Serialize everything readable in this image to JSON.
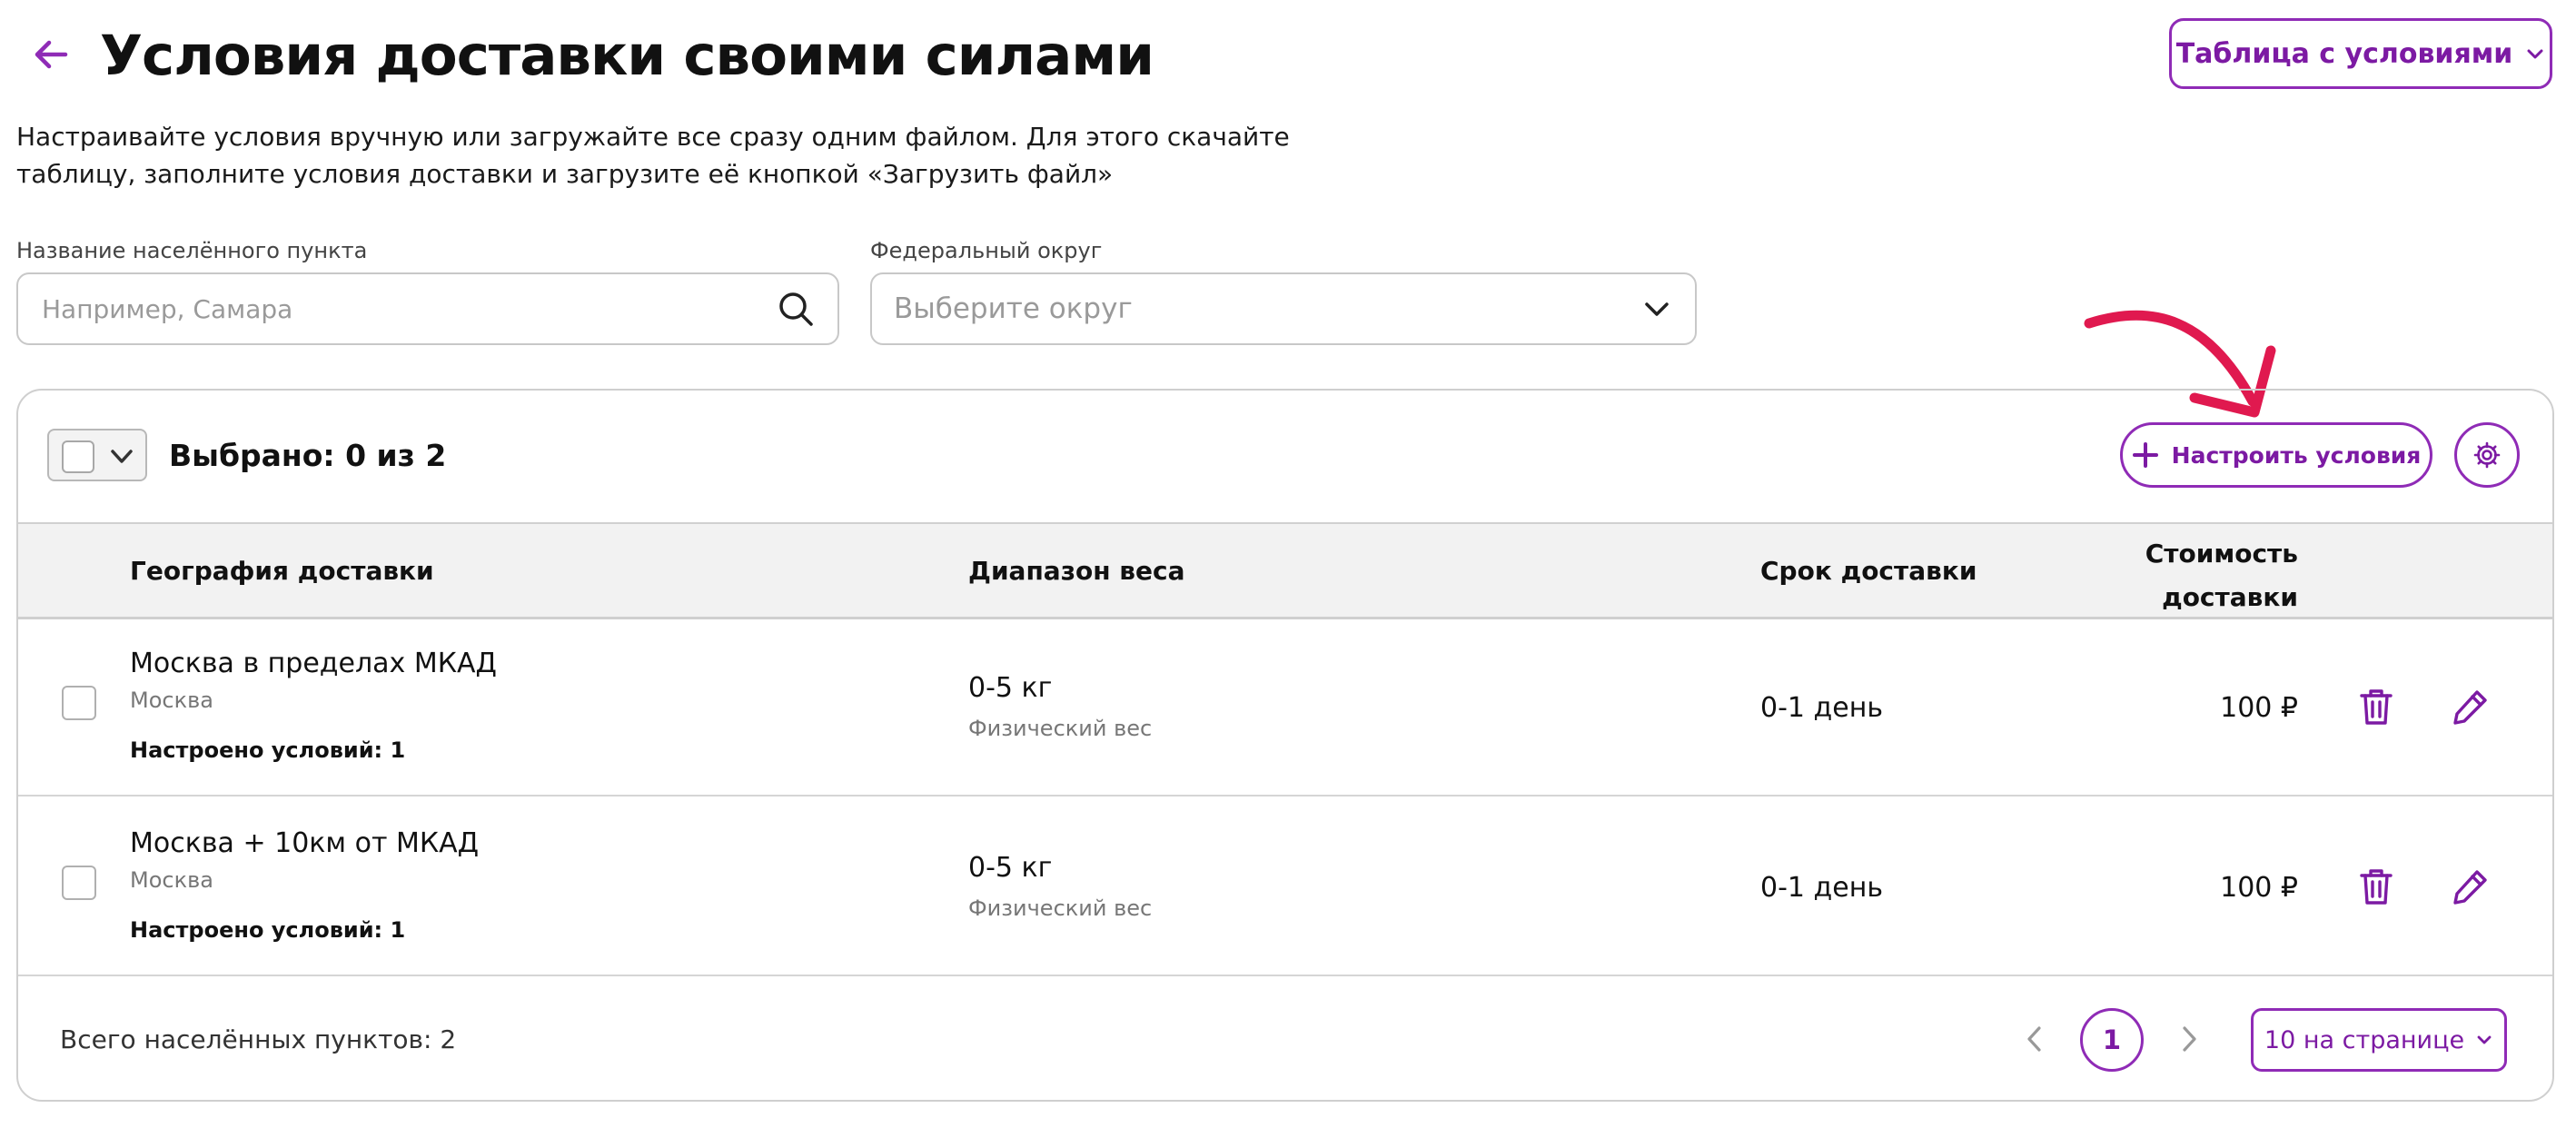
{
  "header": {
    "title": "Условия доставки своими силами",
    "table_button_label": "Таблица с условиями",
    "description": "Настраивайте условия вручную или загружайте все сразу одним файлом. Для этого скачайте таблицу, заполните условия доставки и загрузите её кнопкой «Загрузить файл»"
  },
  "filters": {
    "city_label": "Название населённого пункта",
    "city_placeholder": "Например, Самара",
    "city_value": "",
    "district_label": "Федеральный округ",
    "district_placeholder": "Выберите округ"
  },
  "toolbar": {
    "selected_text": "Выбрано: 0 из 2",
    "configure_label": "Настроить условия"
  },
  "table": {
    "columns": {
      "geography": "География доставки",
      "weight": "Диапазон веса",
      "term": "Срок доставки",
      "cost_line1": "Стоимость",
      "cost_line2": "доставки"
    },
    "rows": [
      {
        "geography": "Москва в пределах МКАД",
        "city": "Москва",
        "conditions": "Настроено условий: 1",
        "weight": "0-5 кг",
        "weight_type": "Физический вес",
        "term": "0-1 день",
        "price": "100 ₽"
      },
      {
        "geography": "Москва + 10км от МКАД",
        "city": "Москва",
        "conditions": "Настроено условий: 1",
        "weight": "0-5 кг",
        "weight_type": "Физический вес",
        "term": "0-1 день",
        "price": "100 ₽"
      }
    ]
  },
  "footer": {
    "total_text": "Всего населённых пунктов: 2",
    "current_page": "1",
    "per_page": "10 на странице"
  },
  "colors": {
    "accent": "#8f2bb6",
    "annotation_arrow": "#e0194f"
  },
  "icons": [
    "back-arrow-icon",
    "chevron-down-icon",
    "search-icon",
    "plus-icon",
    "gear-icon",
    "trash-icon",
    "pencil-icon",
    "chevron-left-icon",
    "chevron-right-icon"
  ]
}
